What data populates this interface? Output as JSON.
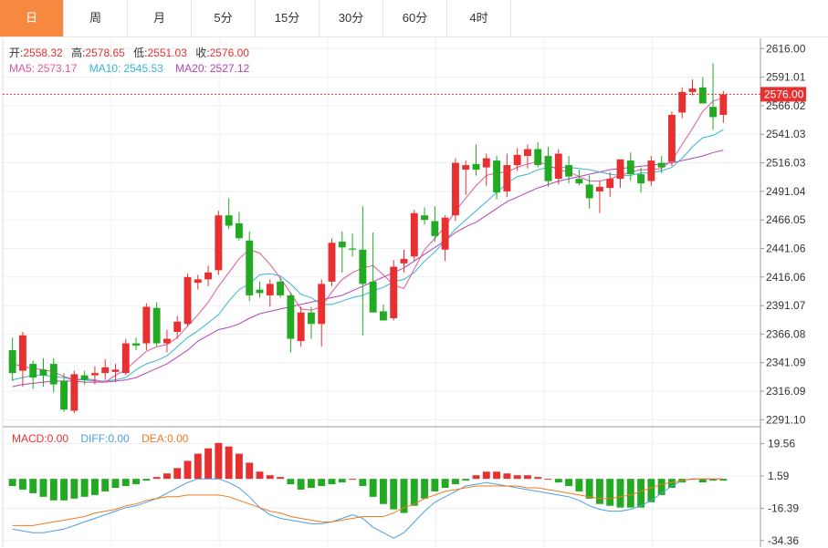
{
  "tabs": [
    "日",
    "周",
    "月",
    "5分",
    "15分",
    "30分",
    "60分",
    "4时"
  ],
  "active_tab": 0,
  "ohlc_info": {
    "open_label": "开:",
    "open": "2558.32",
    "high_label": "高:",
    "high": "2578.65",
    "low_label": "低:",
    "low": "2551.03",
    "close_label": "收:",
    "close": "2576.00"
  },
  "ma_info": {
    "ma5_label": "MA5:",
    "ma5": "2573.17",
    "ma10_label": "MA10:",
    "ma10": "2545.53",
    "ma20_label": "MA20:",
    "ma20": "2527.12"
  },
  "macd_info": {
    "macd_label": "MACD:",
    "macd": "0.00",
    "diff_label": "DIFF:",
    "diff": "0.00",
    "dea_label": "DEA:",
    "dea": "0.00"
  },
  "colors": {
    "up": "#e83030",
    "down": "#22aa22",
    "ma5": "#e0559a",
    "ma10": "#35b5d6",
    "ma20": "#b344b8",
    "diff": "#4a9ee8",
    "dea": "#f07a1e",
    "active_tab": "#f7883f"
  },
  "chart_data": {
    "type": "candlestick",
    "price_axis": {
      "ticks": [
        "2616.00",
        "2591.01",
        "2566.02",
        "2541.03",
        "2516.03",
        "2491.04",
        "2466.05",
        "2441.06",
        "2416.06",
        "2391.07",
        "2366.08",
        "2341.09",
        "2316.09",
        "2291.10"
      ],
      "range": [
        2285,
        2625
      ]
    },
    "current_price": "2576.00",
    "candles": [
      [
        2352,
        2363,
        2325,
        2332
      ],
      [
        2334,
        2368,
        2320,
        2365
      ],
      [
        2340,
        2343,
        2318,
        2328
      ],
      [
        2335,
        2345,
        2320,
        2330
      ],
      [
        2340,
        2345,
        2315,
        2322
      ],
      [
        2325,
        2332,
        2298,
        2300
      ],
      [
        2299,
        2334,
        2297,
        2331
      ],
      [
        2330,
        2334,
        2322,
        2326
      ],
      [
        2330,
        2338,
        2322,
        2332
      ],
      [
        2332,
        2344,
        2326,
        2337
      ],
      [
        2333,
        2340,
        2324,
        2335
      ],
      [
        2332,
        2362,
        2330,
        2358
      ],
      [
        2358,
        2363,
        2352,
        2356
      ],
      [
        2358,
        2393,
        2352,
        2390
      ],
      [
        2389,
        2394,
        2355,
        2358
      ],
      [
        2358,
        2370,
        2350,
        2362
      ],
      [
        2368,
        2382,
        2362,
        2377
      ],
      [
        2375,
        2419,
        2373,
        2416
      ],
      [
        2411,
        2418,
        2405,
        2414
      ],
      [
        2414,
        2426,
        2408,
        2420
      ],
      [
        2422,
        2474,
        2418,
        2470
      ],
      [
        2470,
        2485,
        2458,
        2461
      ],
      [
        2463,
        2473,
        2448,
        2450
      ],
      [
        2448,
        2456,
        2395,
        2400
      ],
      [
        2405,
        2412,
        2398,
        2402
      ],
      [
        2400,
        2414,
        2390,
        2410
      ],
      [
        2412,
        2416,
        2398,
        2400
      ],
      [
        2400,
        2402,
        2350,
        2362
      ],
      [
        2360,
        2390,
        2355,
        2385
      ],
      [
        2385,
        2390,
        2362,
        2375
      ],
      [
        2375,
        2414,
        2355,
        2410
      ],
      [
        2412,
        2450,
        2408,
        2446
      ],
      [
        2447,
        2456,
        2420,
        2442
      ],
      [
        2441,
        2454,
        2434,
        2440
      ],
      [
        2440,
        2478,
        2365,
        2410
      ],
      [
        2412,
        2455,
        2400,
        2385
      ],
      [
        2386,
        2392,
        2380,
        2378
      ],
      [
        2380,
        2431,
        2378,
        2425
      ],
      [
        2428,
        2440,
        2420,
        2432
      ],
      [
        2434,
        2475,
        2430,
        2472
      ],
      [
        2470,
        2477,
        2462,
        2466
      ],
      [
        2465,
        2478,
        2447,
        2452
      ],
      [
        2440,
        2470,
        2430,
        2468
      ],
      [
        2470,
        2520,
        2465,
        2516
      ],
      [
        2510,
        2518,
        2488,
        2514
      ],
      [
        2515,
        2532,
        2505,
        2510
      ],
      [
        2512,
        2524,
        2496,
        2520
      ],
      [
        2518,
        2522,
        2484,
        2490
      ],
      [
        2491,
        2524,
        2486,
        2514
      ],
      [
        2514,
        2529,
        2509,
        2523
      ],
      [
        2522,
        2532,
        2511,
        2528
      ],
      [
        2528,
        2534,
        2512,
        2514
      ],
      [
        2522,
        2530,
        2495,
        2500
      ],
      [
        2502,
        2528,
        2497,
        2524
      ],
      [
        2514,
        2522,
        2498,
        2504
      ],
      [
        2502,
        2510,
        2496,
        2498
      ],
      [
        2497,
        2505,
        2476,
        2485
      ],
      [
        2491,
        2500,
        2472,
        2495
      ],
      [
        2494,
        2508,
        2486,
        2502
      ],
      [
        2502,
        2515,
        2494,
        2519
      ],
      [
        2518,
        2525,
        2500,
        2506
      ],
      [
        2506,
        2512,
        2490,
        2498
      ],
      [
        2500,
        2522,
        2496,
        2518
      ],
      [
        2516,
        2522,
        2507,
        2512
      ],
      [
        2517,
        2561,
        2513,
        2558
      ],
      [
        2560,
        2582,
        2555,
        2578
      ],
      [
        2578,
        2589,
        2575,
        2581
      ],
      [
        2582,
        2591,
        2568,
        2568
      ],
      [
        2565,
        2603,
        2545,
        2556
      ],
      [
        2558,
        2579,
        2551,
        2576
      ]
    ],
    "ma5": [
      2340,
      2338,
      2336,
      2335,
      2333,
      2329,
      2326,
      2327,
      2326,
      2324,
      2330,
      2335,
      2343,
      2351,
      2355,
      2357,
      2363,
      2373,
      2383,
      2394,
      2408,
      2420,
      2432,
      2440,
      2437,
      2427,
      2415,
      2402,
      2388,
      2387,
      2390,
      2403,
      2414,
      2420,
      2424,
      2426,
      2418,
      2409,
      2406,
      2423,
      2440,
      2450,
      2460,
      2474,
      2485,
      2496,
      2505,
      2507,
      2508,
      2512,
      2515,
      2517,
      2514,
      2510,
      2508,
      2504,
      2500,
      2500,
      2502,
      2505,
      2508,
      2510,
      2510,
      2511,
      2518,
      2532,
      2546,
      2561,
      2570,
      2573
    ],
    "ma10": [
      2326,
      2328,
      2330,
      2330,
      2329,
      2328,
      2326,
      2326,
      2325,
      2325,
      2326,
      2328,
      2335,
      2340,
      2343,
      2347,
      2355,
      2363,
      2369,
      2376,
      2383,
      2395,
      2405,
      2410,
      2418,
      2419,
      2417,
      2410,
      2401,
      2398,
      2392,
      2392,
      2395,
      2398,
      2400,
      2404,
      2407,
      2412,
      2414,
      2420,
      2430,
      2438,
      2448,
      2458,
      2466,
      2474,
      2482,
      2490,
      2498,
      2504,
      2506,
      2510,
      2512,
      2512,
      2512,
      2511,
      2510,
      2508,
      2506,
      2505,
      2505,
      2507,
      2507,
      2509,
      2512,
      2520,
      2530,
      2538,
      2540,
      2545
    ],
    "ma20": [
      2320,
      2322,
      2323,
      2324,
      2325,
      2325,
      2325,
      2324,
      2324,
      2324,
      2325,
      2326,
      2328,
      2332,
      2336,
      2340,
      2346,
      2352,
      2360,
      2365,
      2370,
      2372,
      2375,
      2380,
      2384,
      2386,
      2388,
      2390,
      2392,
      2394,
      2396,
      2398,
      2400,
      2404,
      2408,
      2412,
      2416,
      2420,
      2424,
      2430,
      2436,
      2442,
      2448,
      2455,
      2460,
      2464,
      2470,
      2476,
      2482,
      2486,
      2490,
      2494,
      2497,
      2500,
      2502,
      2504,
      2506,
      2508,
      2510,
      2511,
      2512,
      2513,
      2514,
      2515,
      2516,
      2518,
      2520,
      2522,
      2525,
      2527
    ],
    "macd_axis": {
      "ticks": [
        "19.56",
        "1.59",
        "-16.39",
        "-34.36"
      ],
      "range": [
        -38,
        28
      ]
    },
    "macd_hist": [
      -4,
      -6,
      -8,
      -10,
      -12,
      -12,
      -11,
      -10,
      -9,
      -7,
      -5,
      -4,
      -3,
      -1,
      1,
      3,
      6,
      10,
      14,
      17,
      20,
      18,
      14,
      9,
      4,
      2,
      1,
      -3,
      -6,
      -5,
      -4,
      -3,
      -2,
      0,
      -4,
      -10,
      -14,
      -17,
      -19,
      -15,
      -11,
      -7,
      -5,
      -3,
      -1,
      2,
      4,
      4,
      3,
      2,
      2,
      1,
      0,
      -2,
      -4,
      -7,
      -11,
      -14,
      -15,
      -16,
      -16,
      -16,
      -13,
      -9,
      -5,
      -2,
      0,
      -2,
      -1,
      -1
    ],
    "diff": [
      -28,
      -29,
      -30,
      -30,
      -29,
      -28,
      -26,
      -24,
      -22,
      -20,
      -18,
      -16,
      -15,
      -13,
      -11,
      -8,
      -5,
      -2,
      0,
      0,
      0,
      -2,
      -5,
      -10,
      -16,
      -20,
      -22,
      -23,
      -24,
      -25,
      -25,
      -24,
      -22,
      -20,
      -22,
      -27,
      -30,
      -33,
      -30,
      -24,
      -18,
      -13,
      -10,
      -7,
      -4,
      -3,
      -2,
      -3,
      -4,
      -5,
      -6,
      -7,
      -8,
      -9,
      -10,
      -12,
      -15,
      -17,
      -18,
      -18,
      -17,
      -15,
      -12,
      -8,
      -4,
      -1,
      0,
      0,
      0,
      0
    ],
    "dea": [
      -26,
      -26,
      -26,
      -25,
      -24,
      -23,
      -22,
      -21,
      -19,
      -18,
      -17,
      -15,
      -14,
      -12,
      -11,
      -10,
      -10,
      -9,
      -9,
      -9,
      -9,
      -10,
      -12,
      -14,
      -16,
      -18,
      -19,
      -21,
      -22,
      -23,
      -24,
      -24,
      -23,
      -22,
      -21,
      -21,
      -21,
      -19,
      -16,
      -14,
      -11,
      -9,
      -7,
      -6,
      -5,
      -4,
      -4,
      -4,
      -4,
      -4,
      -5,
      -5,
      -6,
      -7,
      -8,
      -9,
      -10,
      -11,
      -11,
      -10,
      -9,
      -7,
      -5,
      -3,
      -2,
      -1,
      0,
      0,
      0,
      0
    ]
  }
}
